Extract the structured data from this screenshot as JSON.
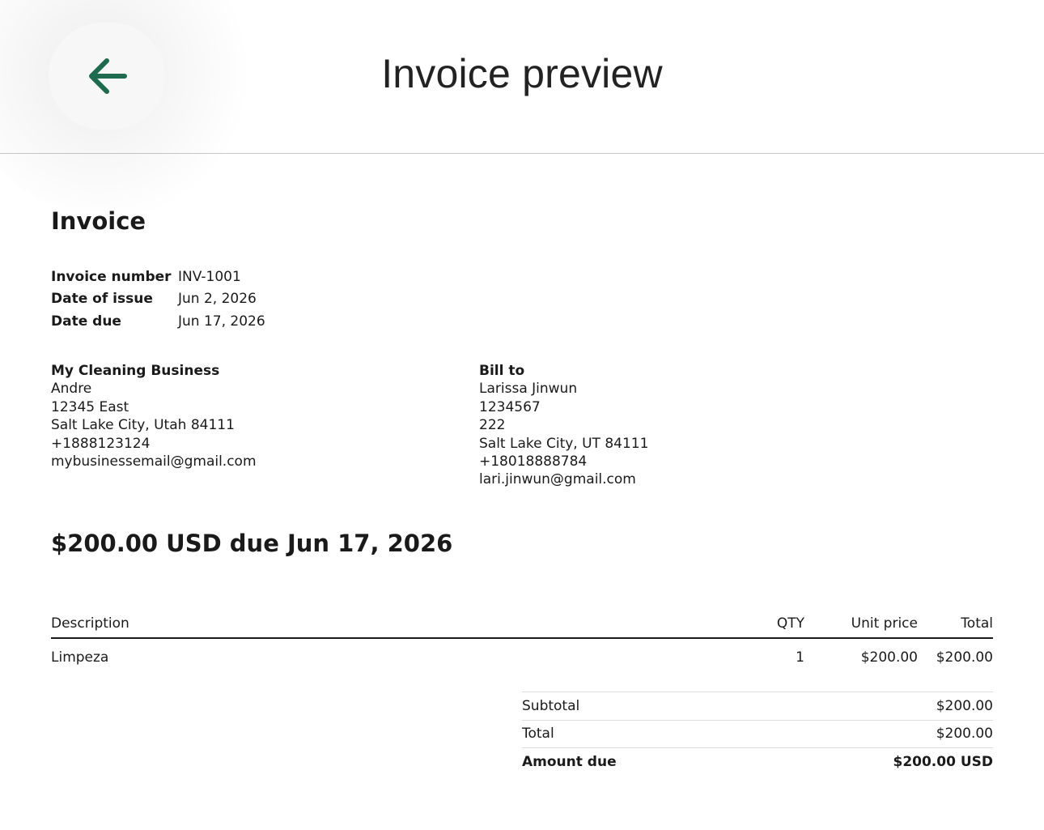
{
  "header": {
    "title": "Invoice preview",
    "back_icon": "arrow-left-icon",
    "accent_color": "#1f6b4f"
  },
  "invoice": {
    "heading": "Invoice",
    "meta": [
      {
        "label": "Invoice number",
        "value": "INV-1001"
      },
      {
        "label": "Date of issue",
        "value": "Jun 2, 2026"
      },
      {
        "label": "Date due",
        "value": "Jun 17, 2026"
      }
    ],
    "from": {
      "name": "My Cleaning Business",
      "lines": [
        "Andre",
        "12345 East",
        "Salt Lake City, Utah 84111",
        "+1888123124",
        "mybusinessemail@gmail.com"
      ]
    },
    "bill_to": {
      "heading": "Bill to",
      "lines": [
        "Larissa Jinwun",
        "1234567",
        "222",
        "Salt Lake City, UT 84111",
        "+18018888784",
        "lari.jinwun@gmail.com"
      ]
    },
    "due_headline": "$200.00 USD due Jun 17, 2026",
    "items_table": {
      "headers": {
        "description": "Description",
        "qty": "QTY",
        "unit_price": "Unit price",
        "total": "Total"
      },
      "rows": [
        {
          "description": "Limpeza",
          "qty": "1",
          "unit_price": "$200.00",
          "total": "$200.00"
        }
      ]
    },
    "totals": [
      {
        "label": "Subtotal",
        "value": "$200.00"
      },
      {
        "label": "Total",
        "value": "$200.00"
      },
      {
        "label": "Amount due",
        "value": "$200.00 USD"
      }
    ]
  }
}
